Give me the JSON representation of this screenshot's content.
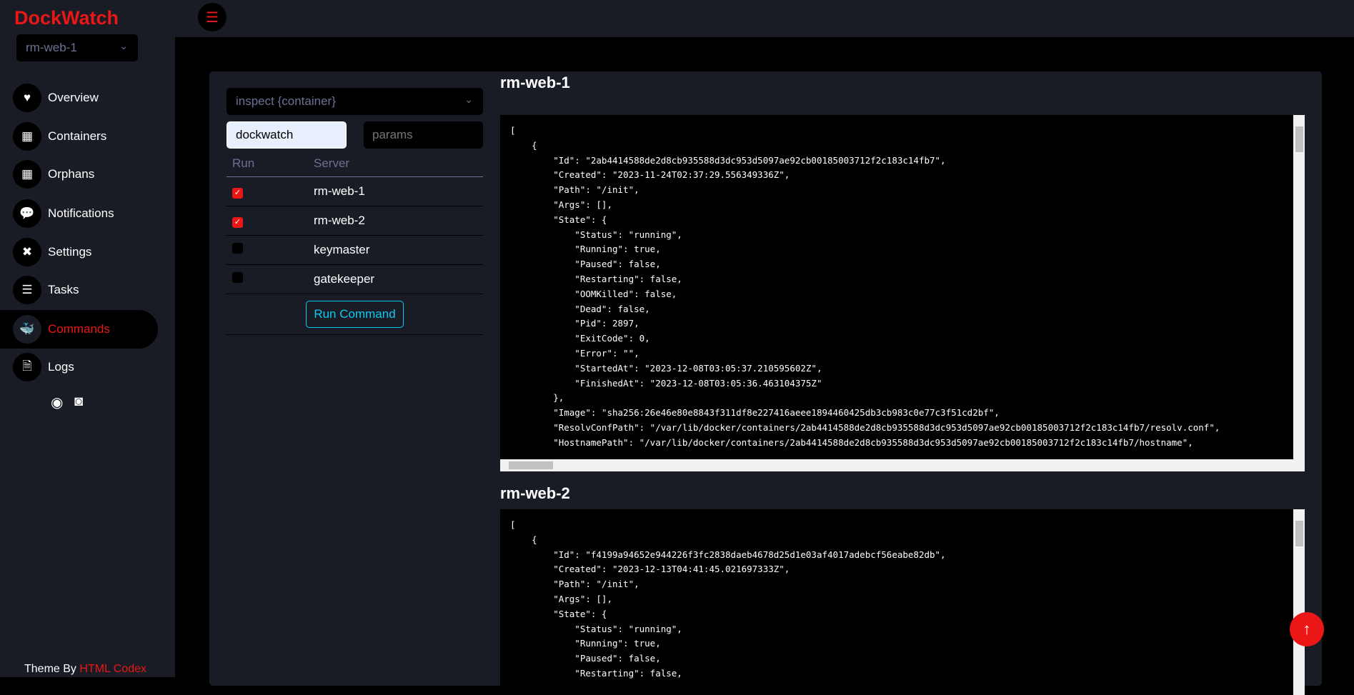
{
  "brand": "DockWatch",
  "server_select": "rm-web-1",
  "nav": [
    {
      "label": "Overview",
      "icon": "heart-pulse-icon",
      "glyph": "♥"
    },
    {
      "label": "Containers",
      "icon": "grid-icon",
      "glyph": "▦"
    },
    {
      "label": "Orphans",
      "icon": "grid-icon",
      "glyph": "▦"
    },
    {
      "label": "Notifications",
      "icon": "chat-icon",
      "glyph": "💬"
    },
    {
      "label": "Settings",
      "icon": "tools-icon",
      "glyph": "✖"
    },
    {
      "label": "Tasks",
      "icon": "list-check-icon",
      "glyph": "☰"
    },
    {
      "label": "Commands",
      "icon": "docker-icon",
      "glyph": "🐳",
      "active": true
    },
    {
      "label": "Logs",
      "icon": "file-code-icon",
      "glyph": "🗎"
    }
  ],
  "footer": {
    "prefix": "Theme By",
    "link": "HTML Codex"
  },
  "command": {
    "selected": "inspect {container}",
    "container_value": "dockwatch",
    "params_placeholder": "params",
    "run_label": "Run Command"
  },
  "table": {
    "headers": [
      "Run",
      "Server"
    ],
    "rows": [
      {
        "server": "rm-web-1",
        "checked": true
      },
      {
        "server": "rm-web-2",
        "checked": true
      },
      {
        "server": "keymaster",
        "checked": false
      },
      {
        "server": "gatekeeper",
        "checked": false
      }
    ]
  },
  "outputs": [
    {
      "title": "rm-web-1",
      "text": "[\n    {\n        \"Id\": \"2ab4414588de2d8cb935588d3dc953d5097ae92cb00185003712f2c183c14fb7\",\n        \"Created\": \"2023-11-24T02:37:29.556349336Z\",\n        \"Path\": \"/init\",\n        \"Args\": [],\n        \"State\": {\n            \"Status\": \"running\",\n            \"Running\": true,\n            \"Paused\": false,\n            \"Restarting\": false,\n            \"OOMKilled\": false,\n            \"Dead\": false,\n            \"Pid\": 2897,\n            \"ExitCode\": 0,\n            \"Error\": \"\",\n            \"StartedAt\": \"2023-12-08T03:05:37.210595602Z\",\n            \"FinishedAt\": \"2023-12-08T03:05:36.463104375Z\"\n        },\n        \"Image\": \"sha256:26e46e80e8843f311df8e227416aeee1894460425db3cb983c0e77c3f51cd2bf\",\n        \"ResolvConfPath\": \"/var/lib/docker/containers/2ab4414588de2d8cb935588d3dc953d5097ae92cb00185003712f2c183c14fb7/resolv.conf\",\n        \"HostnamePath\": \"/var/lib/docker/containers/2ab4414588de2d8cb935588d3dc953d5097ae92cb00185003712f2c183c14fb7/hostname\","
    },
    {
      "title": "rm-web-2",
      "text": "[\n    {\n        \"Id\": \"f4199a94652e944226f3fc2838daeb4678d25d1e03af4017adebcf56eabe82db\",\n        \"Created\": \"2023-12-13T04:41:45.021697333Z\",\n        \"Path\": \"/init\",\n        \"Args\": [],\n        \"State\": {\n            \"Status\": \"running\",\n            \"Running\": true,\n            \"Paused\": false,\n            \"Restarting\": false,"
    }
  ],
  "colors": {
    "accent": "#eb1616",
    "panel": "#191c24",
    "muted": "#6c7293",
    "button": "#0dcaf0"
  }
}
